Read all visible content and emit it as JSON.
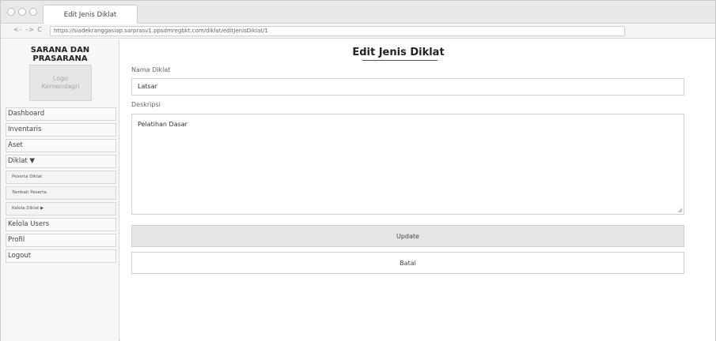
{
  "browser": {
    "tab_title": "Edit Jenis Diklat",
    "nav_buttons": "<- -> C",
    "url": "https://siadekranggasiap.sarprasv1.ppsdmregbkt.com/diklat/editJenisDiklat/1"
  },
  "sidebar": {
    "brand": "SARANA DAN\nPRASARANA",
    "logo_text": "Logo\nKemendagri",
    "items": [
      {
        "label": "Dashboard",
        "type": "main"
      },
      {
        "label": "Inventaris",
        "type": "main"
      },
      {
        "label": "Aset",
        "type": "main"
      },
      {
        "label": "Diklat ▼",
        "type": "main"
      },
      {
        "label": "Peserta Diklat",
        "type": "sub"
      },
      {
        "label": "Tambah Peserta",
        "type": "sub"
      },
      {
        "label": "Kelola Diklat ▶",
        "type": "sub"
      },
      {
        "label": "Kelola Users",
        "type": "main"
      },
      {
        "label": "Profil",
        "type": "main"
      },
      {
        "label": "Logout",
        "type": "main"
      }
    ]
  },
  "form": {
    "title": "Edit Jenis Diklat",
    "name_label": "Nama Diklat",
    "name_value": "Latsar",
    "desc_label": "Deskripsi",
    "desc_value": "Pelatihan Dasar",
    "update_label": "Update",
    "cancel_label": "Batal"
  },
  "icons": {
    "window_controls": "traffic-light-dots",
    "textarea_resize": "resize-handle-icon"
  }
}
